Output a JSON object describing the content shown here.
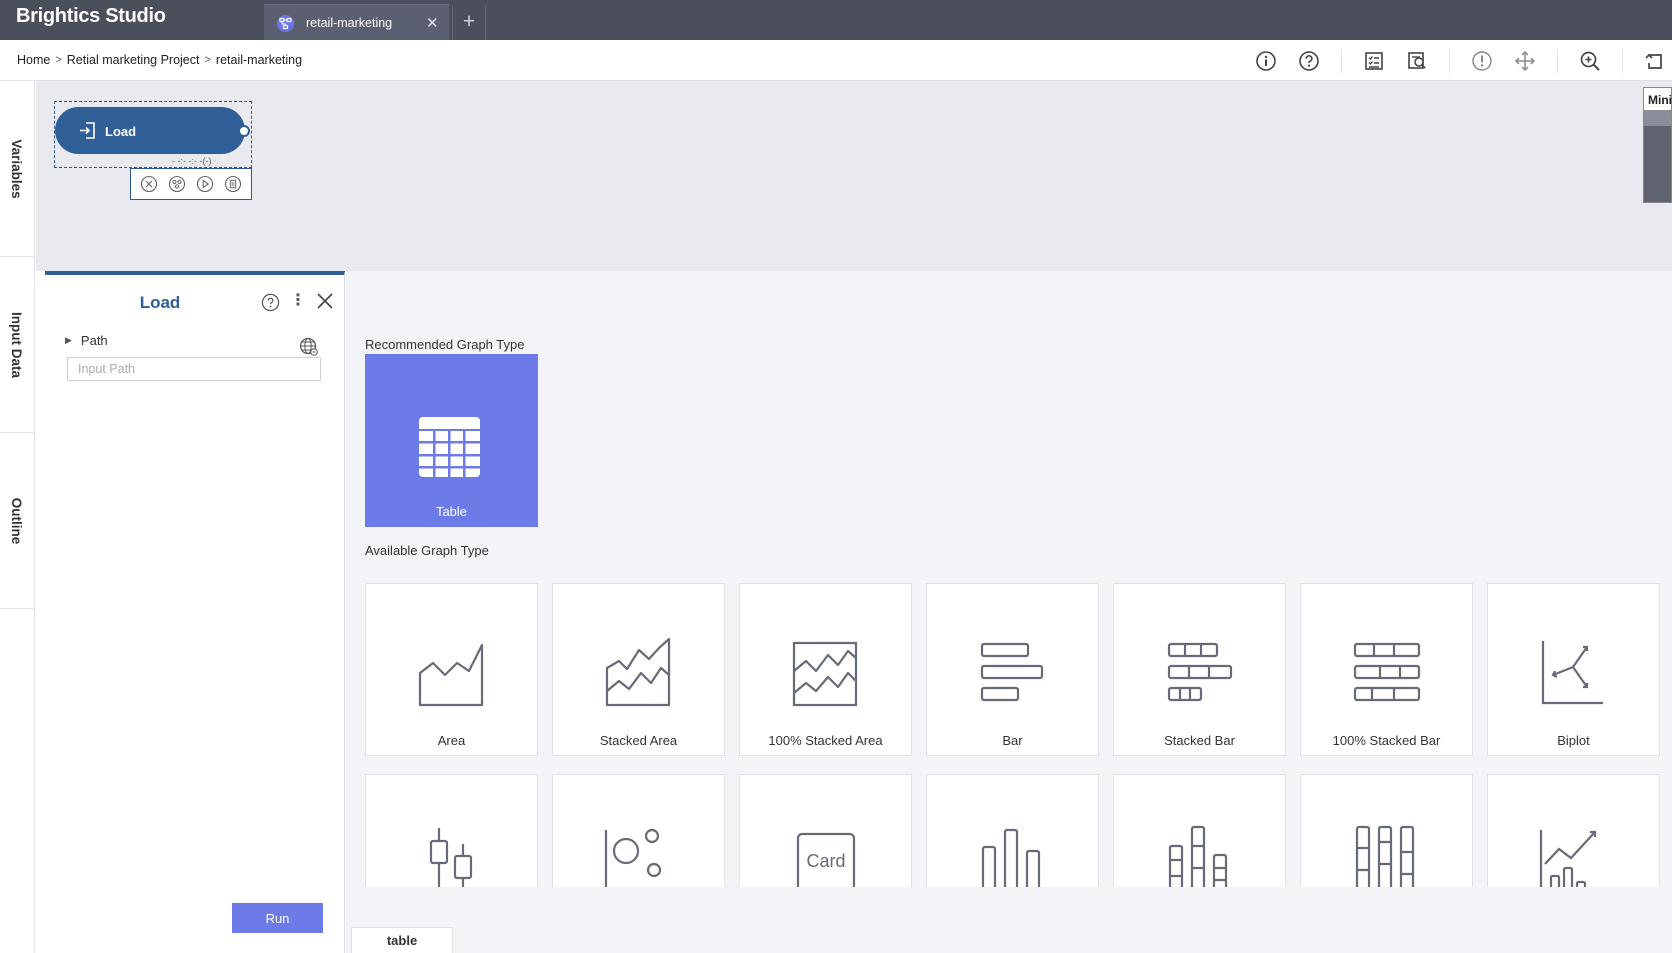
{
  "app": {
    "brand": "Brightics Studio",
    "tabs": [
      {
        "label": "retail-marketing",
        "active": true
      }
    ],
    "add_tab_symbol": "+"
  },
  "breadcrumb": [
    "Home",
    "Retial marketing Project",
    "retail-marketing"
  ],
  "toolbar": {
    "icons": [
      "info-icon",
      "help-icon",
      "checklist-icon",
      "report-icon",
      "warning-icon",
      "move-icon",
      "zoom-in-icon",
      "undo-icon"
    ]
  },
  "left_rail": [
    "Variables",
    "Input Data",
    "Outline"
  ],
  "canvas": {
    "node": {
      "label": "Load",
      "sub_label": "- -:- -:- -(-)"
    },
    "node_actions": [
      "remove-icon",
      "link-icon",
      "run-icon",
      "copy-icon"
    ],
    "minimap_label": "Mini"
  },
  "panel": {
    "title": "Load",
    "more_symbol": "⋮",
    "path_label": "Path",
    "path_placeholder": "Input Path",
    "run_label": "Run"
  },
  "graph": {
    "recommended_label": "Recommended Graph Type",
    "recommended": [
      {
        "label": "Table",
        "icon": "table-icon",
        "selected": true
      }
    ],
    "available_label": "Available Graph Type",
    "available_row1": [
      {
        "label": "Area",
        "icon": "area-chart-icon"
      },
      {
        "label": "Stacked Area",
        "icon": "stacked-area-icon"
      },
      {
        "label": "100% Stacked Area",
        "icon": "stacked-area-100-icon"
      },
      {
        "label": "Bar",
        "icon": "bar-icon"
      },
      {
        "label": "Stacked Bar",
        "icon": "stacked-bar-icon"
      },
      {
        "label": "100% Stacked Bar",
        "icon": "stacked-bar-100-icon"
      },
      {
        "label": "Biplot",
        "icon": "biplot-icon"
      }
    ],
    "available_row2": [
      {
        "icon": "boxplot-icon"
      },
      {
        "icon": "bubble-icon"
      },
      {
        "icon": "card-icon",
        "icon_text": "Card"
      },
      {
        "icon": "column-icon"
      },
      {
        "icon": "stacked-column-icon"
      },
      {
        "icon": "stacked-column-100-icon"
      },
      {
        "icon": "combo-chart-icon"
      }
    ],
    "bottom_tab": "table"
  },
  "colors": {
    "topbar": "#4b4f5c",
    "node": "#2f5f96",
    "accent": "#6c7be8",
    "canvas": "#e8eaf0"
  }
}
